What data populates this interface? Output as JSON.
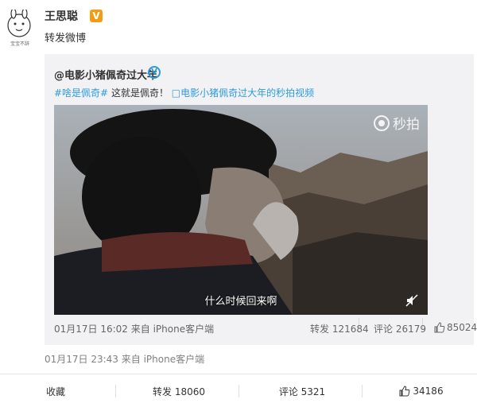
{
  "post": {
    "username": "王思聪",
    "verify_badge": "V",
    "text": "转发微博",
    "avatar_caption": "宝宝不辞",
    "meta": "01月17日 23:43 来自 iPhone客户端"
  },
  "original": {
    "author": "@电影小猪佩奇过大年",
    "verify_badge": "V",
    "hashtag": "#啥是佩奇#",
    "text": " 这就是佩奇！",
    "link": "电影小猪佩奇过大年的秒拍视频",
    "video": {
      "watermark": "秒拍",
      "subtitle": "什么时候回来啊",
      "mute_icon": "mute-icon"
    },
    "meta": "01月17日 16:02 来自 iPhone客户端",
    "repost": "转发 121684",
    "comment": "评论 26179",
    "like": "85024"
  },
  "actions": {
    "favorite": "收藏",
    "repost": "转发 18060",
    "comment": "评论 5321",
    "like": "34186"
  },
  "colors": {
    "link": "#2d9cdb",
    "verify_orange": "#f39c12",
    "repost_bg": "#f2f2f5"
  }
}
